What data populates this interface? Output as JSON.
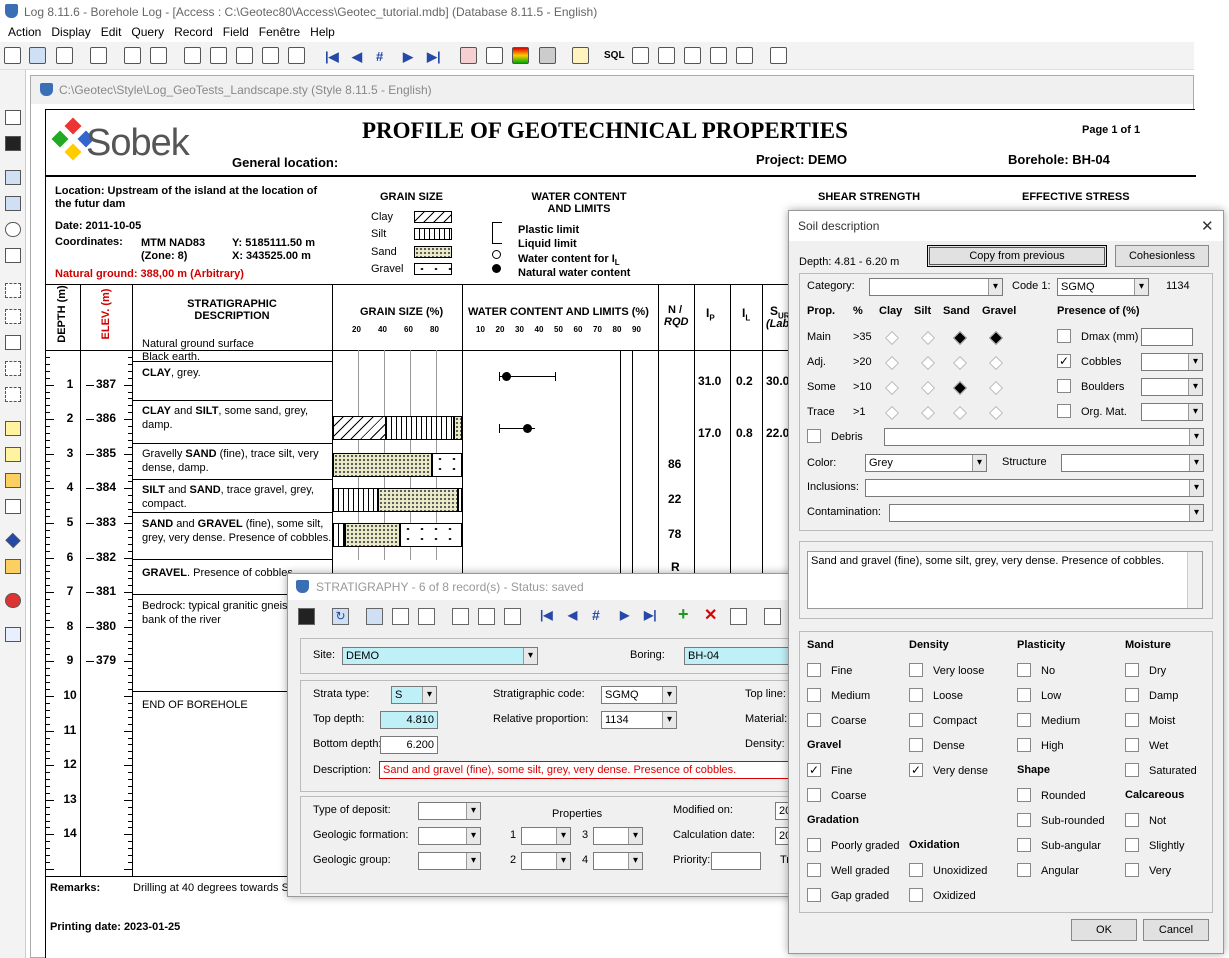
{
  "window": {
    "title": "Log 8.11.6 - Borehole Log - [Access : C:\\Geotec80\\Access\\Geotec_tutorial.mdb] (Database 8.11.5 - English)"
  },
  "menu": [
    "Action",
    "Display",
    "Edit",
    "Query",
    "Record",
    "Field",
    "Fenêtre",
    "Help"
  ],
  "toolbar": {
    "sql": "SQL"
  },
  "document": {
    "title": "C:\\Geotec\\Style\\Log_GeoTests_Landscape.sty (Style 8.11.5 - English)"
  },
  "report": {
    "logo": "Sobek",
    "heading": "PROFILE OF GEOTECHNICAL PROPERTIES",
    "page": "Page 1 of 1",
    "general_location": "General location:",
    "project": "Project: DEMO",
    "borehole": "Borehole: BH-04",
    "location": "Location: Upstream of the island at the location of the futur dam",
    "date": "Date: 2011-10-05",
    "coord_label": "Coordinates:",
    "coord_sys": "MTM  NAD83",
    "zone": "(Zone: 8)",
    "y": "Y:  5185111.50 m",
    "x": "X:    343525.00 m",
    "ground": "Natural ground: 388,00 m (Arbitrary)",
    "grain_size_title": "GRAIN SIZE",
    "grain_legend": [
      "Clay",
      "Silt",
      "Sand",
      "Gravel"
    ],
    "water_title": "WATER CONTENT AND LIMITS",
    "water_legend": [
      "Plastic limit",
      "Liquid limit",
      "Water content for I",
      "Natural water content"
    ],
    "water_legend_sub": "L",
    "shear": "SHEAR STRENGTH",
    "effective": "EFFECTIVE STRESS",
    "col_depth": "DEPTH (m)",
    "col_elev": "ELEV. (m)",
    "col_strat": "STRATIGRAPHIC DESCRIPTION",
    "col_grain": "GRAIN SIZE (%)",
    "col_water": "WATER CONTENT AND LIMITS (%)",
    "col_n": "N /",
    "col_rqd": "RQD",
    "col_ip": "I",
    "col_ip_sub": "P",
    "col_il": "I",
    "col_il_sub": "L",
    "col_sur": "S",
    "col_sur_sub": "UR",
    "col_sur_lab": "(Lab",
    "grain_ticks": [
      "20",
      "40",
      "60",
      "80"
    ],
    "water_ticks": [
      "10",
      "20",
      "30",
      "40",
      "50",
      "60",
      "70",
      "80",
      "90"
    ],
    "natural_surface": "Natural ground surface",
    "depth_ticks": [
      "1",
      "2",
      "3",
      "4",
      "5",
      "6",
      "7",
      "8",
      "9",
      "10",
      "11",
      "12",
      "13",
      "14"
    ],
    "elev_ticks": [
      "387",
      "386",
      "385",
      "384",
      "383",
      "382",
      "381",
      "380",
      "379"
    ],
    "strata": [
      {
        "html": "Black earth."
      },
      {
        "html": "<b>CLAY</b>, grey."
      },
      {
        "html": "<b>CLAY</b> and <b>SILT</b>, some sand, grey, damp."
      },
      {
        "html": "Gravelly <b>SAND</b> (fine), trace silt, very dense, damp."
      },
      {
        "html": "<b>SILT</b> and <b>SAND</b>, trace gravel, grey, compact."
      },
      {
        "html": "<b>SAND</b> and <b>GRAVEL</b> (fine), some silt, grey, very dense. Presence of cobbles."
      },
      {
        "html": "<b>GRAVEL</b>. Presence of cobbles"
      },
      {
        "html": "Bedrock: typical granitic gneis the right bank of the river"
      },
      {
        "html": "END OF BOREHOLE"
      }
    ],
    "n_values": [
      "86",
      "22",
      "78",
      "R"
    ],
    "ip_values": [
      "31.0",
      "17.0"
    ],
    "il_values": [
      "0.2",
      "0.8"
    ],
    "sur_values": [
      "30.0",
      "22.0"
    ],
    "remarks_label": "Remarks:",
    "remarks": "Drilling at 40 degrees towards S",
    "printing": "Printing date:  2023-01-25"
  },
  "strat_dialog": {
    "title": "STRATIGRAPHY - 6 of 8 record(s) - Status: saved",
    "site_label": "Site:",
    "site": "DEMO",
    "boring_label": "Boring:",
    "boring": "BH-04",
    "strata_type_label": "Strata type:",
    "strata_type": "S",
    "strat_code_label": "Stratigraphic code:",
    "strat_code": "SGMQ",
    "top_line_label": "Top line:",
    "top_depth_label": "Top depth:",
    "top_depth": "4.810",
    "rel_prop_label": "Relative proportion:",
    "rel_prop": "1134",
    "material_label": "Material:",
    "bottom_depth_label": "Bottom depth:",
    "bottom_depth": "6.200",
    "density_label": "Density:",
    "desc_label": "Description:",
    "description": "Sand and gravel (fine), some silt, grey, very dense. Presence of cobbles.",
    "deposit_label": "Type of deposit:",
    "properties_label": "Properties",
    "modified_label": "Modified on:",
    "modified": "20",
    "formation_label": "Geologic formation:",
    "calc_label": "Calculation date:",
    "calc": "20",
    "group_label": "Geologic group:",
    "priority_label": "Priority:",
    "tr": "Tr",
    "prop_nums": [
      "1",
      "3",
      "2",
      "4"
    ]
  },
  "soil_dialog": {
    "title": "Soil description",
    "depth": "Depth:  4.81 - 6.20  m",
    "copy_button": "Copy from previous",
    "cohesionless_button": "Cohesionless",
    "category_label": "Category:",
    "code1_label": "Code 1:",
    "code1": "SGMQ",
    "code1_num": "1134",
    "prop_header": [
      "Prop.",
      "%",
      "Clay",
      "Silt",
      "Sand",
      "Gravel"
    ],
    "prop_rows": [
      {
        "name": "Main",
        "pct": ">35"
      },
      {
        "name": "Adj.",
        "pct": ">20"
      },
      {
        "name": "Some",
        "pct": ">10"
      },
      {
        "name": "Trace",
        "pct": ">1"
      }
    ],
    "presence_title": "Presence of (%)",
    "presence": [
      "Dmax (mm)",
      "Cobbles",
      "Boulders",
      "Org. Mat."
    ],
    "debris": "Debris",
    "color_label": "Color:",
    "color": "Grey",
    "structure_label": "Structure",
    "inclusions_label": "Inclusions:",
    "contamination_label": "Contamination:",
    "summary": "Sand and gravel (fine), some silt, grey, very dense. Presence of cobbles.",
    "sand_title": "Sand",
    "sand": [
      "Fine",
      "Medium",
      "Coarse"
    ],
    "gravel_title": "Gravel",
    "gravel": [
      "Fine",
      "Coarse"
    ],
    "gradation_title": "Gradation",
    "gradation": [
      "Poorly graded",
      "Well graded",
      "Gap graded"
    ],
    "density_title": "Density",
    "density": [
      "Very loose",
      "Loose",
      "Compact",
      "Dense",
      "Very dense"
    ],
    "oxidation_title": "Oxidation",
    "oxidation": [
      "Unoxidized",
      "Oxidized"
    ],
    "plasticity_title": "Plasticity",
    "plasticity": [
      "No",
      "Low",
      "Medium",
      "High"
    ],
    "shape_title": "Shape",
    "shape": [
      "Rounded",
      "Sub-rounded",
      "Sub-angular",
      "Angular"
    ],
    "moisture_title": "Moisture",
    "moisture": [
      "Dry",
      "Damp",
      "Moist",
      "Wet",
      "Saturated"
    ],
    "calcareous_title": "Calcareous",
    "calcareous": [
      "Not",
      "Slightly",
      "Very"
    ],
    "ok": "OK",
    "cancel": "Cancel",
    "check_mark": "✓"
  },
  "colors": {
    "accent": "#3a6eb5",
    "field_highlight": "#bff0f7",
    "red": "#d00000"
  }
}
